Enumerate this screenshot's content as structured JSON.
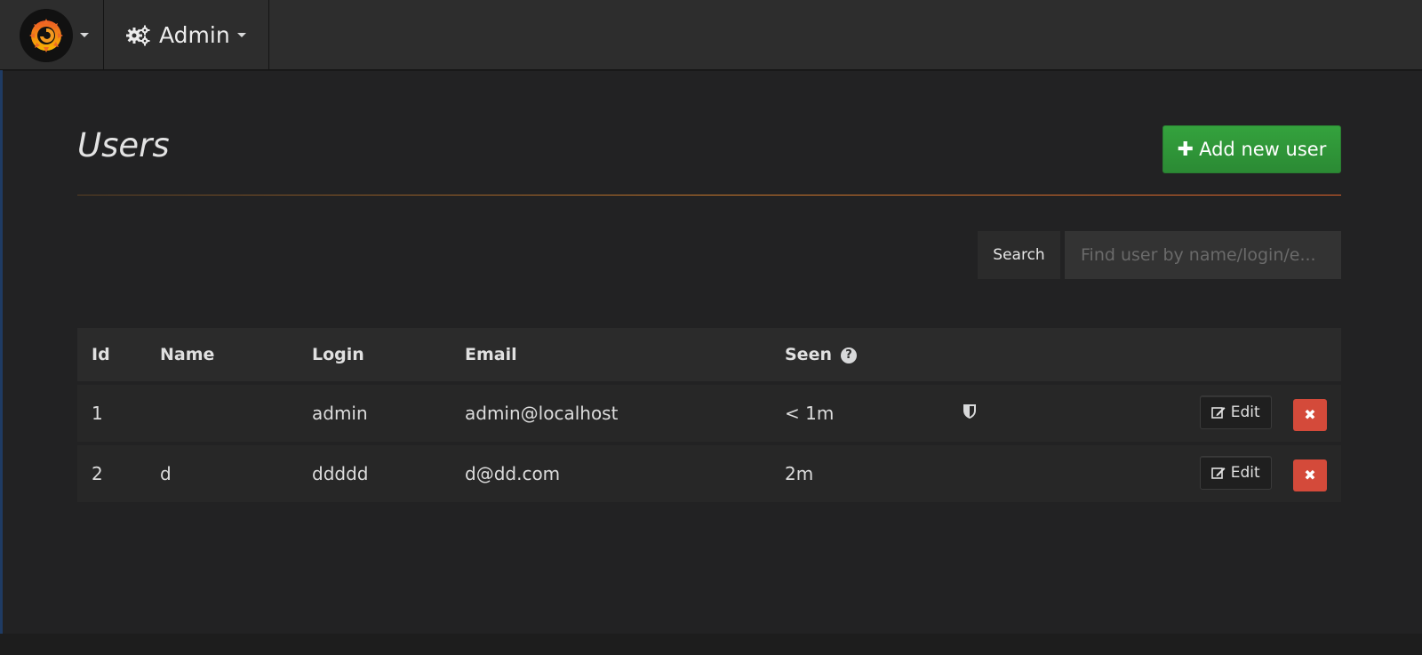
{
  "nav": {
    "menu": "Admin"
  },
  "page": {
    "title": "Users",
    "add_button": "Add new user"
  },
  "search": {
    "label": "Search",
    "placeholder": "Find user by name/login/e..."
  },
  "table": {
    "headers": {
      "id": "Id",
      "name": "Name",
      "login": "Login",
      "email": "Email",
      "seen": "Seen"
    },
    "rows": [
      {
        "id": "1",
        "name": "",
        "login": "admin",
        "email": "admin@localhost",
        "seen": "< 1m",
        "admin_badge": true
      },
      {
        "id": "2",
        "name": "d",
        "login": "ddddd",
        "email": "d@dd.com",
        "seen": "2m",
        "admin_badge": false
      }
    ],
    "edit_label": "Edit",
    "delete_symbol": "✖"
  },
  "colors": {
    "accent_green": "#2b8a34",
    "danger_red": "#d44a3a",
    "divider_orange": "#e0632b"
  },
  "icons": {
    "logo": "grafana-logo-icon",
    "admin": "cogs-icon",
    "add": "plus-icon",
    "help": "question-circle-icon",
    "admin_badge": "shield-icon",
    "edit": "edit-icon",
    "delete": "times-icon"
  }
}
